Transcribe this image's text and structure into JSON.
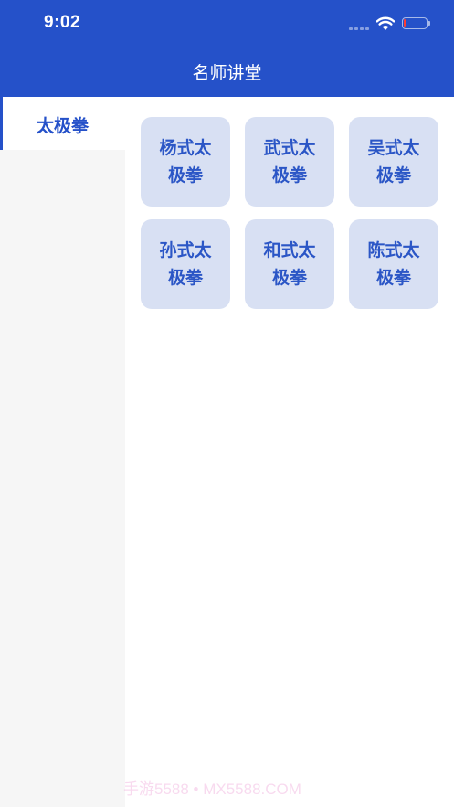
{
  "status_bar": {
    "time": "9:02",
    "battery_level": 0.1,
    "battery_color": "#ff3b30"
  },
  "nav": {
    "title": "名师讲堂"
  },
  "sidebar": {
    "items": [
      {
        "label": "太极拳",
        "selected": true
      }
    ]
  },
  "grid": {
    "tiles": [
      {
        "label": "杨式太极拳"
      },
      {
        "label": "武式太极拳"
      },
      {
        "label": "吴式太极拳"
      },
      {
        "label": "孙式太极拳"
      },
      {
        "label": "和式太极拳"
      },
      {
        "label": "陈式太极拳"
      }
    ]
  },
  "watermark": "手游5588 • MX5588.COM",
  "colors": {
    "accent": "#2551c9",
    "tile_bg": "#d8e0f3",
    "tile_text": "#2b56c6",
    "sidebar_bg": "#f6f6f6"
  }
}
